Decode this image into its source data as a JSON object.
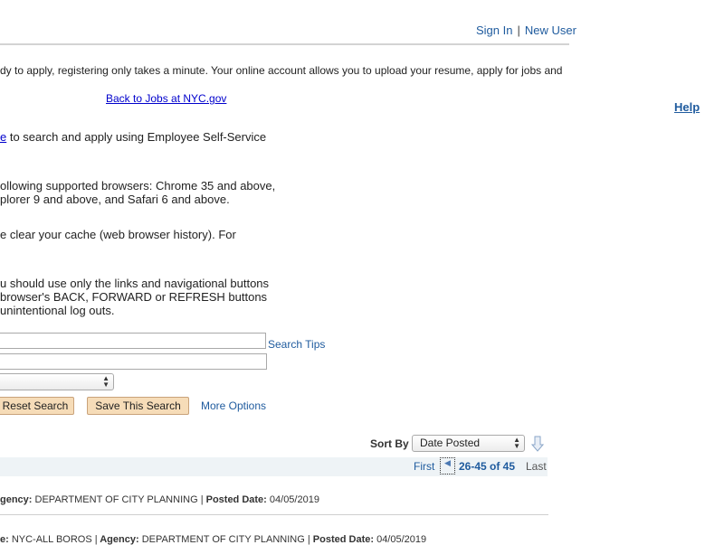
{
  "header": {
    "sign_in": "Sign In",
    "separator": "|",
    "new_user": "New User"
  },
  "help": "Help",
  "intro": {
    "line1": "dy to apply, registering only takes a minute. Your online account allows you to upload your resume, apply for jobs and",
    "back_link": "Back to Jobs at NYC.gov",
    "ess_link_fragment": "e",
    "ess_text": " to search and apply using Employee Self-Service",
    "browsers_line1": "ollowing supported browsers: Chrome 35 and above,",
    "browsers_line2": "plorer 9 and above, and Safari 6 and above.",
    "cache_line": "e clear your cache (web browser history). For",
    "nav_line1": "u should use only the links and navigational buttons",
    "nav_line2": " browser's BACK, FORWARD or REFRESH buttons",
    "nav_line3": " unintentional log outs."
  },
  "search": {
    "search_tips": "Search Tips",
    "keyword_value": "",
    "location_value": "",
    "select_value": ""
  },
  "buttons": {
    "reset": "Reset Search",
    "save": "Save This Search",
    "more_options": "More Options"
  },
  "sort": {
    "label": "Sort By",
    "value": "Date Posted"
  },
  "pager": {
    "first": "First",
    "range": "26-45 of 45",
    "last": "Last"
  },
  "results": [
    {
      "prefix": "gency:",
      "agency": " DEPARTMENT OF CITY PLANNING ",
      "sep": "|",
      "posted_label": " Posted Date:",
      "posted": " 04/05/2019"
    },
    {
      "loc_prefix": "e:",
      "location": " NYC-ALL BOROS ",
      "sep1": "|",
      "agency_label": " Agency:",
      "agency": " DEPARTMENT OF CITY PLANNING ",
      "sep2": "|",
      "posted_label": " Posted Date:",
      "posted": " 04/05/2019"
    }
  ]
}
